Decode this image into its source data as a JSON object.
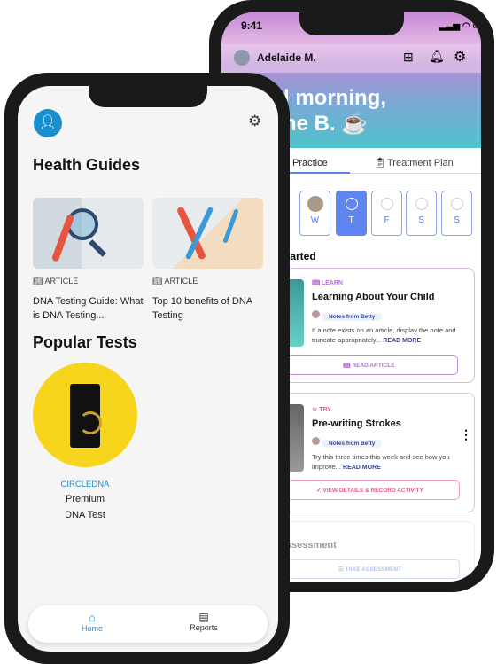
{
  "back_phone": {
    "status_time": "9:41",
    "user_name": "Adelaide M.",
    "greeting_line1": "l morning,",
    "greeting_line2": "ne B. ☕",
    "tabs": [
      {
        "label": "Practice",
        "active": true
      },
      {
        "label": "Treatment Plan",
        "active": false
      }
    ],
    "days": [
      {
        "label": "W",
        "avatar": true
      },
      {
        "label": "T",
        "selected": true
      },
      {
        "label": "F"
      },
      {
        "label": "S"
      },
      {
        "label": "S"
      }
    ],
    "section_title": "itarted",
    "cards": [
      {
        "tag": "LEARN",
        "title": "Learning About Your Child",
        "note_from": "Notes from Betty",
        "text": "If a note exists on an article, display the note and truncate appropriately...",
        "read_more": "READ MORE",
        "button": "READ ARTICLE",
        "accent": "#b86fd0"
      },
      {
        "tag": "TRY",
        "title": "Pre-writing Strokes",
        "note_from": "Notes from Betty",
        "text": "Try this three times this week and see how you improve...",
        "read_more": "READ MORE",
        "button": "VIEW DETAILS & RECORD ACTIVITY",
        "accent": "#e8578a"
      },
      {
        "tag": "CT",
        "title": "Assessment",
        "button": "TAKE ASSESSMENT",
        "accent": "#9bb3e8"
      }
    ]
  },
  "front_phone": {
    "health_guides_title": "Health Guides",
    "guides": [
      {
        "tag": "ARTICLE",
        "title": "DNA Testing Guide: What is DNA Testing..."
      },
      {
        "tag": "ARTICLE",
        "title": "Top 10 benefits of DNA Testing"
      }
    ],
    "popular_tests_title": "Popular Tests",
    "test": {
      "brand": "CIRCLEDNA",
      "name_line1": "Premium",
      "name_line2": "DNA Test"
    },
    "nav": [
      {
        "label": "Home",
        "active": true
      },
      {
        "label": "Reports",
        "active": false
      }
    ],
    "colors": {
      "accent": "#1a8fd0",
      "yellow": "#f7d51d"
    }
  }
}
